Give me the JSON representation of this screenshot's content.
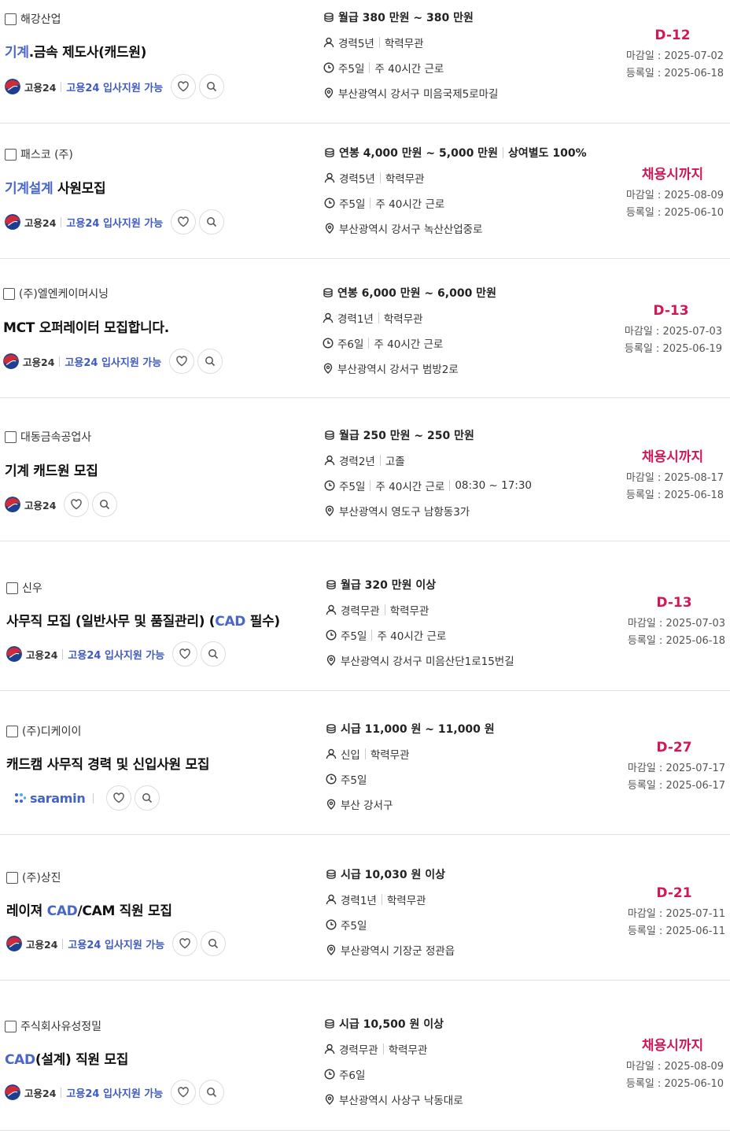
{
  "jobs": [
    {
      "company": "해강산업",
      "title_parts": [
        {
          "text": "기계",
          "hl": true
        },
        {
          "text": ".금속 제도사(캐드원)",
          "hl": false
        }
      ],
      "source": "고용24",
      "support": "고용24 입사지원 가능",
      "pay": [
        "월급 380 만원 ~ 380 만원"
      ],
      "career": [
        "경력5년",
        "학력무관"
      ],
      "schedule": [
        "주5일",
        "주 40시간 근로"
      ],
      "location": "부산광역시 강서구 미음국제5로마길",
      "dday": "D-12",
      "deadline": "마감일 : 2025-07-02",
      "registered": "등록일 : 2025-06-18"
    },
    {
      "company": "패스코 (주)",
      "title_parts": [
        {
          "text": "기계설계",
          "hl": true
        },
        {
          "text": " 사원모집",
          "hl": false
        }
      ],
      "source": "고용24",
      "support": "고용24 입사지원 가능",
      "pay": [
        "연봉 4,000 만원 ~ 5,000 만원",
        "상여별도 100%"
      ],
      "career": [
        "경력5년",
        "학력무관"
      ],
      "schedule": [
        "주5일",
        "주 40시간 근로"
      ],
      "location": "부산광역시 강서구 녹산산업중로",
      "dday": "채용시까지",
      "deadline": "마감일 : 2025-08-09",
      "registered": "등록일 : 2025-06-10"
    },
    {
      "company": "(주)엘엔케이머시닝",
      "title_parts": [
        {
          "text": "MCT 오퍼레이터 모집합니다.",
          "hl": false
        }
      ],
      "source": "고용24",
      "support": "고용24 입사지원 가능",
      "pay": [
        "연봉 6,000 만원 ~ 6,000 만원"
      ],
      "career": [
        "경력1년",
        "학력무관"
      ],
      "schedule": [
        "주6일",
        "주 40시간 근로"
      ],
      "location": "부산광역시 강서구 범방2로",
      "dday": "D-13",
      "deadline": "마감일 : 2025-07-03",
      "registered": "등록일 : 2025-06-19"
    },
    {
      "company": "대동금속공업사",
      "title_parts": [
        {
          "text": "기계 캐드원 모집",
          "hl": false
        }
      ],
      "source": "고용24",
      "support": "",
      "pay": [
        "월급 250 만원 ~ 250 만원"
      ],
      "career": [
        "경력2년",
        "고졸"
      ],
      "schedule": [
        "주5일",
        "주 40시간 근로",
        "08:30 ~ 17:30"
      ],
      "location": "부산광역시 영도구 남항동3가",
      "dday": "채용시까지",
      "deadline": "마감일 : 2025-08-17",
      "registered": "등록일 : 2025-06-18"
    },
    {
      "company": "신우",
      "title_parts": [
        {
          "text": "사무직 모집 (일반사무 및 품질관리) (",
          "hl": false
        },
        {
          "text": "CAD",
          "hl": true
        },
        {
          "text": " 필수)",
          "hl": false
        }
      ],
      "source": "고용24",
      "support": "고용24 입사지원 가능",
      "pay": [
        "월급 320 만원 이상"
      ],
      "career": [
        "경력무관",
        "학력무관"
      ],
      "schedule": [
        "주5일",
        "주 40시간 근로"
      ],
      "location": "부산광역시 강서구 미음산단1로15번길",
      "dday": "D-13",
      "deadline": "마감일 : 2025-07-03",
      "registered": "등록일 : 2025-06-18"
    },
    {
      "company": "(주)디케이이",
      "title_parts": [
        {
          "text": "캐드캠 사무직 경력 및 신입사원 모집",
          "hl": false
        }
      ],
      "source": "saramin",
      "support": "",
      "pay": [
        "시급 11,000 원 ~ 11,000 원"
      ],
      "career": [
        "신입",
        "학력무관"
      ],
      "schedule": [
        "주5일"
      ],
      "location": "부산 강서구",
      "dday": "D-27",
      "deadline": "마감일 : 2025-07-17",
      "registered": "등록일 : 2025-06-17"
    },
    {
      "company": "(주)상진",
      "title_parts": [
        {
          "text": "레이져 ",
          "hl": false
        },
        {
          "text": "CAD",
          "hl": true
        },
        {
          "text": "/CAM 직원 모집",
          "hl": false
        }
      ],
      "source": "고용24",
      "support": "고용24 입사지원 가능",
      "pay": [
        "시급 10,030 원 이상"
      ],
      "career": [
        "경력1년",
        "학력무관"
      ],
      "schedule": [
        "주5일"
      ],
      "location": "부산광역시 기장군 정관읍",
      "dday": "D-21",
      "deadline": "마감일 : 2025-07-11",
      "registered": "등록일 : 2025-06-11"
    },
    {
      "company": "주식회사유성정밀",
      "title_parts": [
        {
          "text": "CAD",
          "hl": true
        },
        {
          "text": "(설계) 직원 모집",
          "hl": false
        }
      ],
      "source": "고용24",
      "support": "고용24 입사지원 가능",
      "pay": [
        "시급 10,500 원 이상"
      ],
      "career": [
        "경력무관",
        "학력무관"
      ],
      "schedule": [
        "주6일"
      ],
      "location": "부산광역시 사상구 낙동대로",
      "dday": "채용시까지",
      "deadline": "마감일 : 2025-08-09",
      "registered": "등록일 : 2025-06-10"
    }
  ]
}
